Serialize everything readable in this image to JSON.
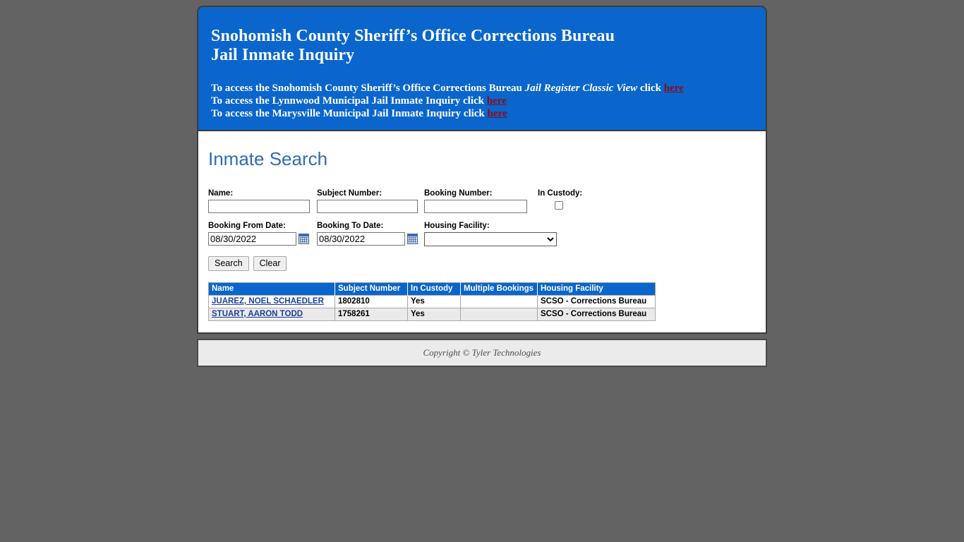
{
  "banner": {
    "title_line1": "Snohomish County Sheriff’s Office Corrections Bureau",
    "title_line2": "Jail Inmate Inquiry",
    "link_line1_pre": "To access the Snohomish County Sheriff’s Office Corrections Bureau ",
    "link_line1_italic": "Jail Register Classic View",
    "link_line1_mid": " click ",
    "link_line1_link": "here",
    "link_line2_pre": "To access the Lynnwood Municipal Jail Inmate Inquiry click ",
    "link_line2_link": "here",
    "link_line3_pre": "To access the Marysville Municipal Jail Inmate Inquiry click ",
    "link_line3_link": "here",
    "bg_color": "#0a66cc",
    "link_color": "#8b0c18"
  },
  "section": {
    "title": "Inmate Search",
    "title_color": "#2f6bb5"
  },
  "form": {
    "name_label": "Name:",
    "name_value": "",
    "subject_label": "Subject Number:",
    "subject_value": "",
    "booking_label": "Booking Number:",
    "booking_value": "",
    "in_custody_label": "In Custody:",
    "in_custody_checked": false,
    "booking_from_label": "Booking From Date:",
    "booking_from_value": "08/30/2022",
    "booking_to_label": "Booking To Date:",
    "booking_to_value": "08/30/2022",
    "housing_label": "Housing Facility:",
    "housing_value": "",
    "housing_options": [
      ""
    ],
    "calendar_icon": "calendar-icon",
    "search_button": "Search",
    "clear_button": "Clear"
  },
  "results": {
    "columns": [
      "Name",
      "Subject Number",
      "In Custody",
      "Multiple Bookings",
      "Housing Facility"
    ],
    "rows": [
      {
        "name": "JUAREZ, NOEL SCHAEDLER",
        "subject_number": "1802810",
        "in_custody": "Yes",
        "multiple_bookings": "",
        "housing_facility": "SCSO - Corrections Bureau"
      },
      {
        "name": "STUART, AARON TODD",
        "subject_number": "1758261",
        "in_custody": "Yes",
        "multiple_bookings": "",
        "housing_facility": "SCSO - Corrections Bureau"
      }
    ]
  },
  "footer": {
    "copyright": "Copyright © Tyler Technologies"
  }
}
